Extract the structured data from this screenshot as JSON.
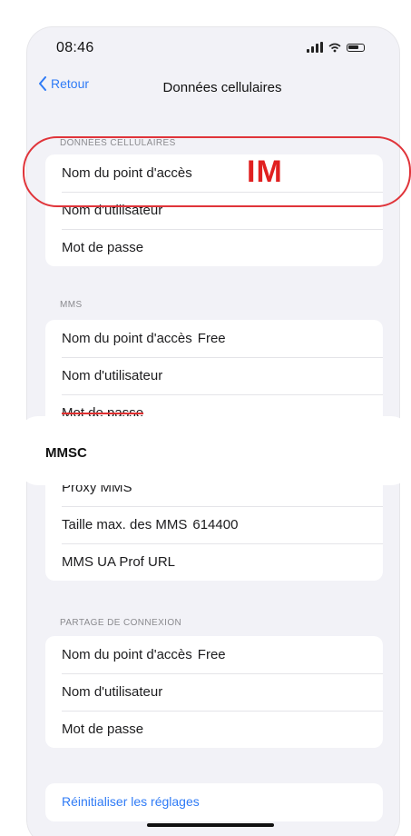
{
  "status_bar": {
    "time": "08:46"
  },
  "nav": {
    "back_label": "Retour",
    "title": "Données cellulaires"
  },
  "sections": {
    "cellular": {
      "header": "DONNÉES CELLULAIRES",
      "rows": [
        {
          "label": "Nom du point d'accès",
          "value": ""
        },
        {
          "label": "Nom d'utilisateur",
          "value": ""
        },
        {
          "label": "Mot de passe",
          "value": ""
        }
      ]
    },
    "mms": {
      "header": "MMS",
      "rows": [
        {
          "label": "Nom du point d'accès",
          "value": "Free"
        },
        {
          "label": "Nom d'utilisateur",
          "value": ""
        },
        {
          "label": "Mot de passe",
          "value": ""
        },
        {
          "label": "MMSC",
          "value": ""
        },
        {
          "label": "Proxy MMS",
          "value": ""
        },
        {
          "label": "Taille max. des MMS",
          "value": "614400"
        },
        {
          "label": "MMS UA Prof URL",
          "value": ""
        }
      ]
    },
    "hotspot": {
      "header": "PARTAGE DE CONNEXION",
      "rows": [
        {
          "label": "Nom du point d'accès",
          "value": "Free"
        },
        {
          "label": "Nom d'utilisateur",
          "value": ""
        },
        {
          "label": "Mot de passe",
          "value": ""
        }
      ]
    }
  },
  "reset": {
    "label": "Réinitialiser les réglages"
  },
  "annotation": {
    "text": "IM",
    "color": "#e02020"
  },
  "colors": {
    "accent": "#2f7bf6",
    "annotation": "#e0343a",
    "background": "#f2f2f7"
  }
}
